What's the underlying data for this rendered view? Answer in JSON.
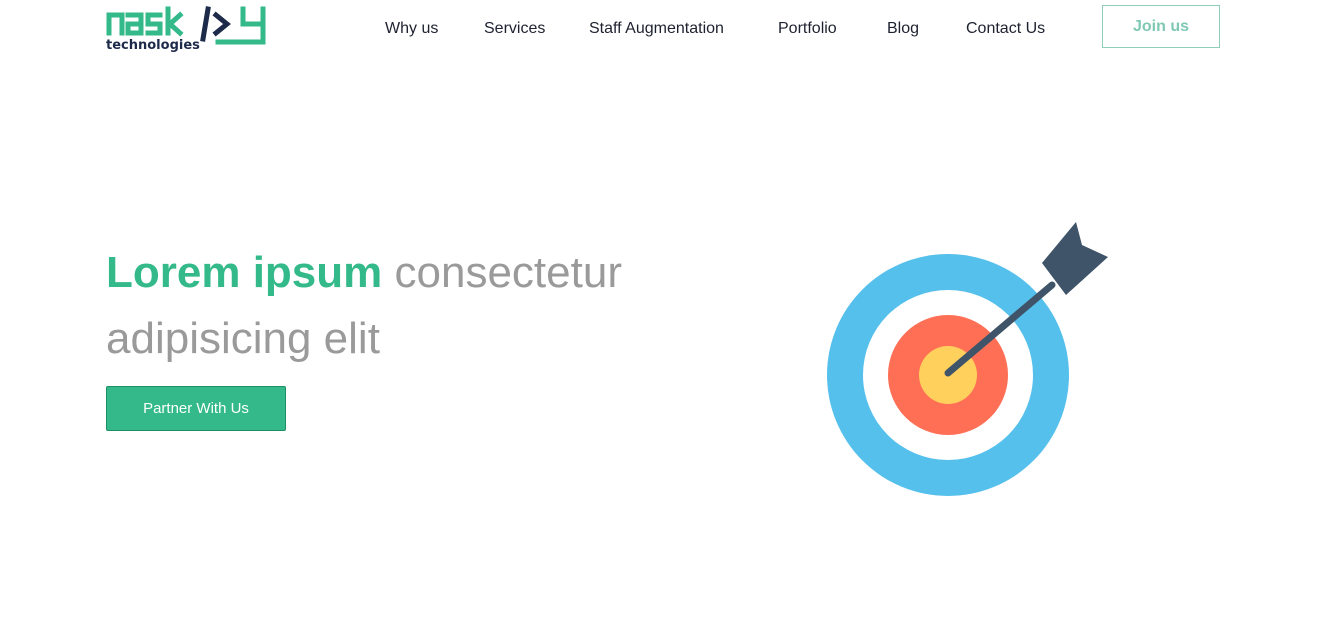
{
  "logo": {
    "wordmark": "naskay",
    "tagline": "technologies",
    "brand_green": "#33b98a",
    "brand_navy": "#1e2a4a"
  },
  "nav": {
    "items": [
      {
        "label": "Why us"
      },
      {
        "label": "Services"
      },
      {
        "label": "Staff Augmentation"
      },
      {
        "label": "Portfolio"
      },
      {
        "label": "Blog"
      },
      {
        "label": "Contact Us"
      }
    ],
    "join_label": "Join us"
  },
  "hero": {
    "title_accent": "Lorem ipsum",
    "title_rest": "consectetur adipisicing elit",
    "cta_label": "Partner With Us"
  },
  "illustration": {
    "icon": "dartboard-target-icon",
    "colors": {
      "outer_ring": "#55c0ec",
      "white_ring": "#ffffff",
      "red_ring": "#ff6f55",
      "bullseye": "#ffd05c",
      "dart": "#3f5468"
    }
  },
  "colors": {
    "accent": "#33b98a",
    "text_dark": "#1e2230",
    "text_muted": "#9a9a9a"
  }
}
